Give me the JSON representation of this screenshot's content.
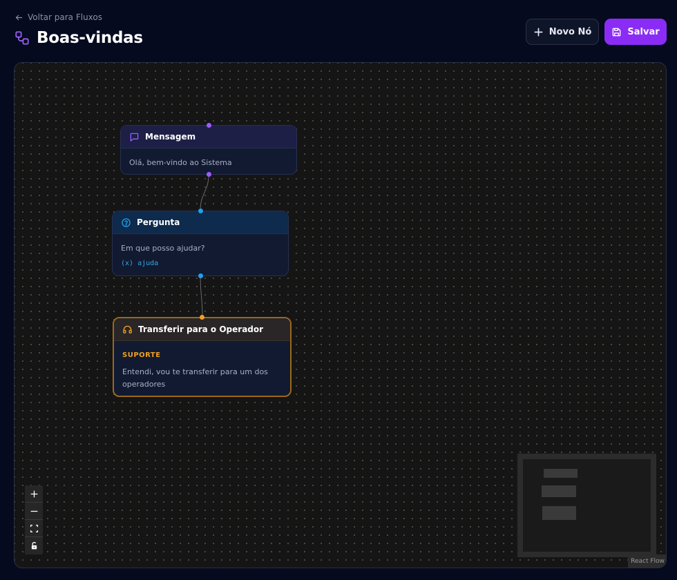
{
  "header": {
    "back_label": "Voltar para Fluxos",
    "title": "Boas-vindas",
    "new_node_label": "Novo Nó",
    "save_label": "Salvar"
  },
  "nodes": {
    "message": {
      "type_label": "Mensagem",
      "text": "Olá, bem-vindo ao Sistema",
      "icon": "message-icon",
      "color": "#9b5cff"
    },
    "question": {
      "type_label": "Pergunta",
      "text": "Em que posso ajudar?",
      "variable": "ajuda",
      "variable_icon": "(x)",
      "icon": "question-icon",
      "color": "#1ea0f0"
    },
    "operator": {
      "type_label": "Transferir para o Operador",
      "queue": "SUPORTE",
      "text": "Entendi, vou te transferir para um dos operadores",
      "icon": "headset-icon",
      "color": "#f0a020"
    }
  },
  "controls": [
    "zoom-in",
    "zoom-out",
    "fit-view",
    "lock"
  ],
  "attribution": "React Flow",
  "colors": {
    "accent": "#8a2cf5",
    "background": "#050a1e",
    "canvas": "#151515"
  }
}
